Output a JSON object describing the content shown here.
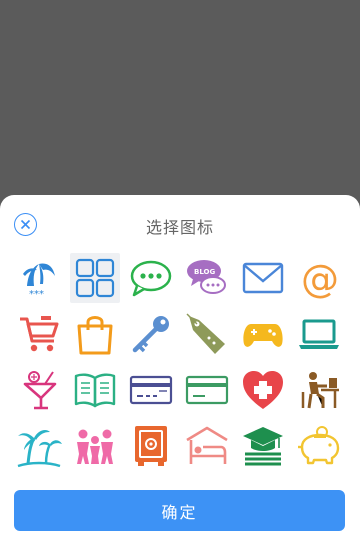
{
  "dialog": {
    "title": "选择图标",
    "confirm_label": "确定"
  },
  "colors": {
    "accent": "#3d92f5",
    "overlay": "#5b5b5b"
  },
  "icons": [
    {
      "name": "palm-trees-stars-icon",
      "text": "***"
    },
    {
      "name": "grid-apps-icon",
      "selected": true
    },
    {
      "name": "chat-bubble-icon"
    },
    {
      "name": "blog-bubble-icon",
      "text": "BLOG"
    },
    {
      "name": "mail-envelope-icon"
    },
    {
      "name": "at-sign-icon",
      "text": "@"
    },
    {
      "name": "shopping-cart-icon"
    },
    {
      "name": "shopping-bag-icon"
    },
    {
      "name": "key-icon"
    },
    {
      "name": "price-tag-icon"
    },
    {
      "name": "gamepad-icon"
    },
    {
      "name": "laptop-icon"
    },
    {
      "name": "cocktail-icon"
    },
    {
      "name": "open-book-icon"
    },
    {
      "name": "credit-card-purple-icon"
    },
    {
      "name": "credit-card-green-icon"
    },
    {
      "name": "medical-heart-icon"
    },
    {
      "name": "desk-worker-icon"
    },
    {
      "name": "palm-island-icon"
    },
    {
      "name": "family-people-icon"
    },
    {
      "name": "safe-box-icon"
    },
    {
      "name": "hotel-bed-icon"
    },
    {
      "name": "graduation-cap-icon"
    },
    {
      "name": "piggy-bank-icon"
    }
  ]
}
